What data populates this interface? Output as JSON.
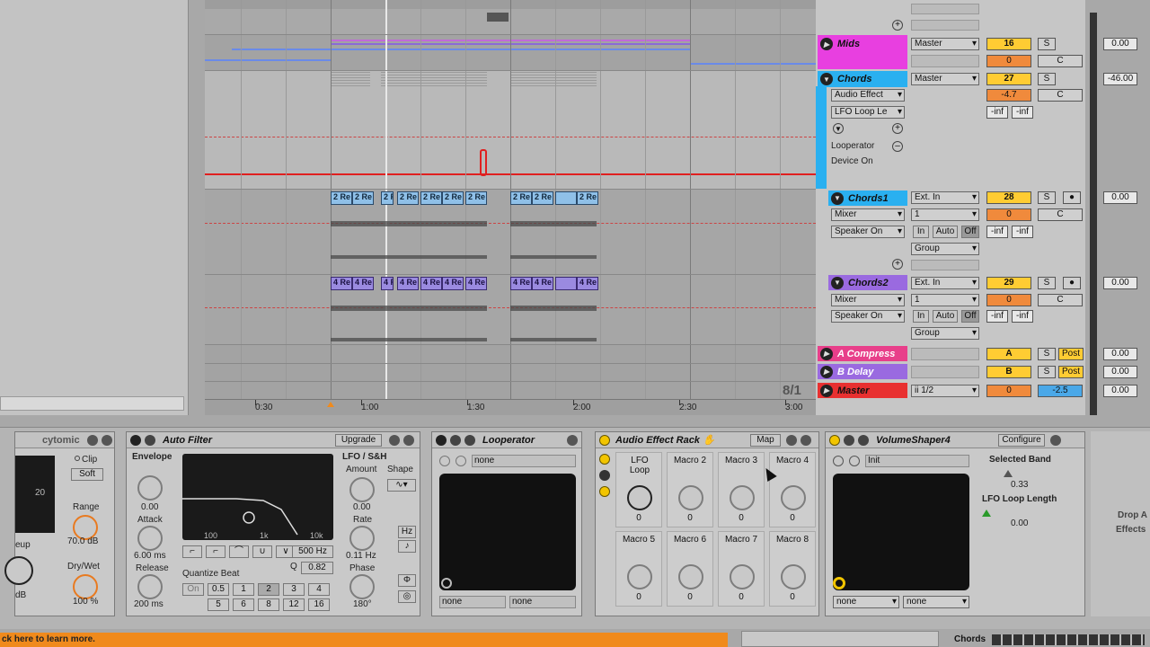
{
  "ruler": {
    "labels": [
      "0:30",
      "1:00",
      "1:30",
      "2:00",
      "2:30",
      "3:00"
    ],
    "zoom": "8/1"
  },
  "clips": {
    "chords1": [
      "2 Re",
      "2 Re",
      "2 Re",
      "2 Re",
      "2 Re",
      "2 Re",
      "2 Re",
      "2 Re",
      "2 Re",
      "2 Re"
    ],
    "chords2": [
      "4 Re",
      "4 Re",
      "4 Re",
      "4 Re",
      "4 Re",
      "4 Re",
      "4 Re",
      "4 Re",
      "4 Re",
      "4 Re"
    ]
  },
  "tracks": {
    "mids": {
      "name": "Mids",
      "output": "Master",
      "number": "16",
      "vol": "0",
      "pan": "C",
      "send": "0.00",
      "solo": "S"
    },
    "chords": {
      "name": "Chords",
      "output": "Master",
      "number": "27",
      "vol": "-4.7",
      "pan": "C",
      "send": "-46.00",
      "chain_select": "Audio Effect",
      "chain_param": "LFO Loop Le",
      "inf1": "-inf",
      "inf2": "-inf",
      "device_line1": "Looperator",
      "device_line2": "Device On",
      "solo": "S"
    },
    "chords1": {
      "name": "Chords1",
      "input": "Ext. In",
      "channel": "1",
      "mixer": "Mixer",
      "monitor_out": "Speaker On",
      "number": "28",
      "vol": "0",
      "pan": "C",
      "send": "0.00",
      "group": "Group",
      "mon_in": "In",
      "mon_auto": "Auto",
      "mon_off": "Off",
      "inf1": "-inf",
      "inf2": "-inf",
      "solo": "S"
    },
    "chords2": {
      "name": "Chords2",
      "input": "Ext. In",
      "channel": "1",
      "mixer": "Mixer",
      "monitor_out": "Speaker On",
      "number": "29",
      "vol": "0",
      "pan": "C",
      "send": "0.00",
      "group": "Group",
      "mon_in": "In",
      "mon_auto": "Auto",
      "mon_off": "Off",
      "inf1": "-inf",
      "inf2": "-inf",
      "solo": "S"
    },
    "compress": {
      "name": "A Compress",
      "number": "A",
      "solo": "S",
      "post": "Post",
      "send": "0.00"
    },
    "delay": {
      "name": "B Delay",
      "number": "B",
      "solo": "S",
      "post": "Post",
      "send": "0.00"
    },
    "master": {
      "name": "Master",
      "cue": "ii 1/2",
      "vol": "0",
      "pan": "-2.5",
      "send": "0.00"
    }
  },
  "devices": {
    "cytomic": {
      "name": "cytomic",
      "clip_label": "Clip",
      "soft": "Soft",
      "range_label": "Range",
      "range_val": "70.0 dB",
      "drywet_label": "Dry/Wet",
      "drywet_val": "100 %",
      "eup": "eup",
      "db": "dB",
      "scale": "20"
    },
    "autofilter": {
      "name": "Auto Filter",
      "upgrade": "Upgrade",
      "envelope": "Envelope",
      "env_val": "0.00",
      "attack": "Attack",
      "attack_val": "6.00 ms",
      "release": "Release",
      "release_val": "200 ms",
      "freq_100": "100",
      "freq_1k": "1k",
      "freq_10k": "10k",
      "freq": "500 Hz",
      "q_label": "Q",
      "q_val": "0.82",
      "quantize": "Quantize Beat",
      "q_on": "On",
      "q_vals": [
        "0.5",
        "1",
        "2",
        "3",
        "4",
        "5",
        "6",
        "8",
        "12",
        "16"
      ],
      "lfo_label": "LFO / S&H",
      "shape_label": "Shape",
      "amount": "Amount",
      "amount_val": "0.00",
      "rate": "Rate",
      "rate_val": "0.11 Hz",
      "hz": "Hz",
      "phase": "Phase",
      "phase_val": "180°"
    },
    "looperator": {
      "name": "Looperator",
      "preset": "none",
      "out1": "none",
      "out2": "none"
    },
    "rack": {
      "name": "Audio Effect Rack",
      "map": "Map",
      "macros": [
        {
          "name": "LFO Loop",
          "value": "0"
        },
        {
          "name": "Macro 2",
          "value": "0"
        },
        {
          "name": "Macro 3",
          "value": "0"
        },
        {
          "name": "Macro 4",
          "value": "0"
        },
        {
          "name": "Macro 5",
          "value": "0"
        },
        {
          "name": "Macro 6",
          "value": "0"
        },
        {
          "name": "Macro 7",
          "value": "0"
        },
        {
          "name": "Macro 8",
          "value": "0"
        }
      ]
    },
    "volumeshaper": {
      "name": "VolumeShaper4",
      "configure": "Configure",
      "preset": "Init",
      "selected_band": "Selected Band",
      "band_val": "0.33",
      "loop_length": "LFO Loop Length",
      "loop_val": "0.00",
      "out1": "none",
      "out2": "none"
    },
    "drop": {
      "line1": "Drop A",
      "line2": "Effects"
    }
  },
  "statusbar": {
    "text": "ck here to learn more.",
    "track": "Chords"
  },
  "colors": {
    "mids": "#e83fe0",
    "chords": "#2ab0f0",
    "chords1": "#2ab0f0",
    "chords2": "#9a6ae0",
    "compress": "#e83f8a",
    "delay": "#9a6ae0",
    "master": "#e83030"
  }
}
